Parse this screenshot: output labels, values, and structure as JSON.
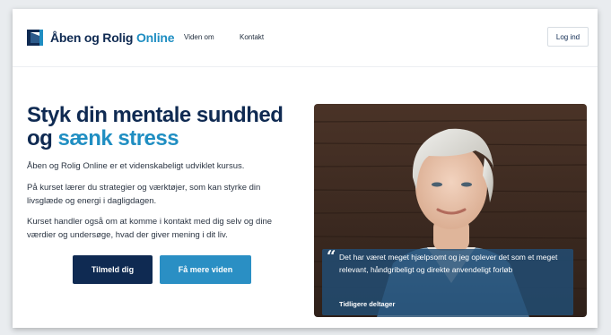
{
  "header": {
    "brand_name_part1": "Åben og Rolig",
    "brand_name_part2": "Online",
    "nav": [
      "Viden om",
      "Kontakt"
    ],
    "login_label": "Log ind"
  },
  "hero": {
    "title_line1": "Styk din mentale sundhed",
    "title_line2_plain": "og",
    "title_line2_highlight": "sænk stress",
    "paragraphs": [
      "Åben og Rolig Online er et videnskabeligt udviklet kursus.",
      "På kurset lærer du strategier og værktøjer, som kan styrke din livsglæde og energi i dagligdagen.",
      "Kurset handler også om at komme i kontakt med dig selv og dine værdier og undersøge, hvad der giver mening i dit liv."
    ],
    "primary_button": "Tilmeld dig",
    "secondary_button": "Få mere viden"
  },
  "testimonial": {
    "quote_mark": "“",
    "text": "Det har været meget hjælpsomt og jeg oplever det som et meget relevant, håndgribeligt og direkte anvendeligt forløb",
    "author": "Tidligere deltager"
  },
  "colors": {
    "brand_navy": "#0f2a52",
    "brand_blue": "#1f8ec2",
    "quote_overlay": "#214e76"
  }
}
